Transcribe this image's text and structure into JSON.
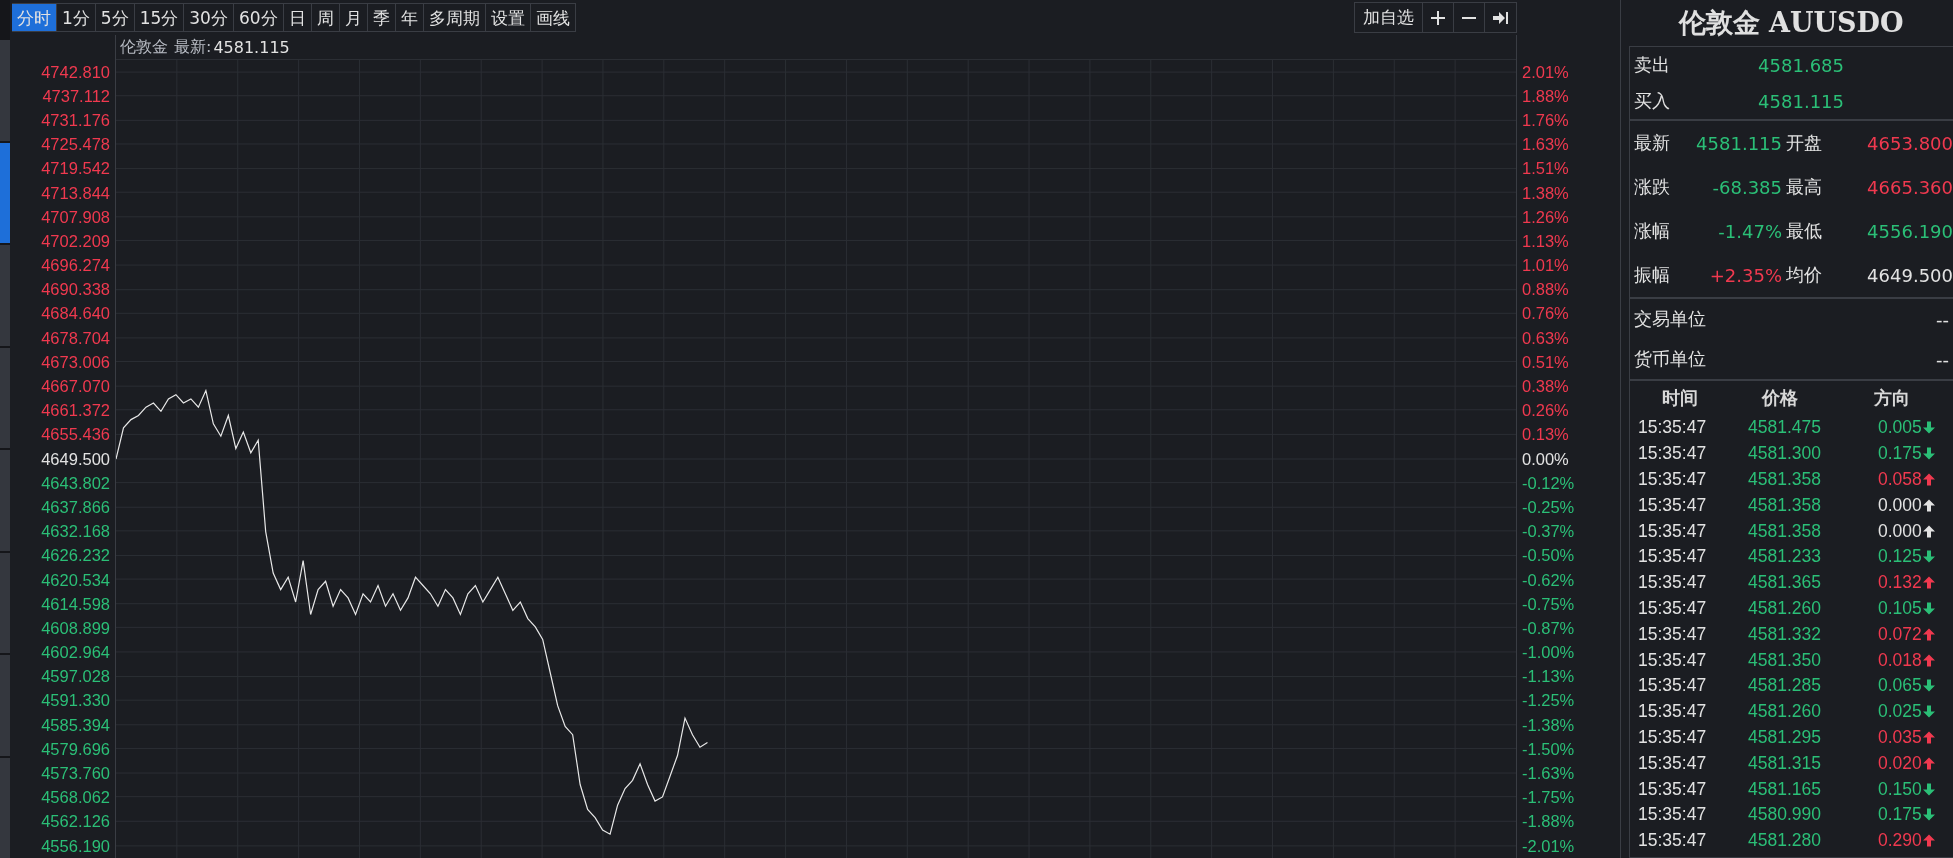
{
  "side_tabs": [
    {
      "selected": false
    },
    {
      "selected": true
    },
    {
      "selected": false
    },
    {
      "selected": false
    },
    {
      "selected": false
    },
    {
      "selected": false
    },
    {
      "selected": false
    },
    {
      "selected": false
    }
  ],
  "periods": [
    {
      "label": "分时",
      "selected": true
    },
    {
      "label": "1分",
      "selected": false
    },
    {
      "label": "5分",
      "selected": false
    },
    {
      "label": "15分",
      "selected": false
    },
    {
      "label": "30分",
      "selected": false
    },
    {
      "label": "60分",
      "selected": false
    },
    {
      "label": "日",
      "selected": false
    },
    {
      "label": "周",
      "selected": false
    },
    {
      "label": "月",
      "selected": false
    },
    {
      "label": "季",
      "selected": false
    },
    {
      "label": "年",
      "selected": false
    },
    {
      "label": "多周期",
      "selected": false
    },
    {
      "label": "设置",
      "selected": false
    },
    {
      "label": "画线",
      "selected": false
    }
  ],
  "toolbar_actions": {
    "watchlist": "加自选"
  },
  "chart_header": {
    "instrument": "伦敦金",
    "latest_label": "最新:",
    "latest": "4581.115"
  },
  "chart": {
    "right_axis_labels": [
      {
        "label": "2.01%",
        "color": "#f0394f"
      },
      {
        "label": "1.88%",
        "color": "#f0394f"
      },
      {
        "label": "1.76%",
        "color": "#f0394f"
      },
      {
        "label": "1.63%",
        "color": "#f0394f"
      },
      {
        "label": "1.51%",
        "color": "#f0394f"
      },
      {
        "label": "1.38%",
        "color": "#f0394f"
      },
      {
        "label": "1.26%",
        "color": "#f0394f"
      },
      {
        "label": "1.13%",
        "color": "#f0394f"
      },
      {
        "label": "1.01%",
        "color": "#f0394f"
      },
      {
        "label": "0.88%",
        "color": "#f0394f"
      },
      {
        "label": "0.76%",
        "color": "#f0394f"
      },
      {
        "label": "0.63%",
        "color": "#f0394f"
      },
      {
        "label": "0.51%",
        "color": "#f0394f"
      },
      {
        "label": "0.38%",
        "color": "#f0394f"
      },
      {
        "label": "0.26%",
        "color": "#f0394f"
      },
      {
        "label": "0.13%",
        "color": "#f0394f"
      },
      {
        "label": "0.00%",
        "color": "#e2e2e2"
      },
      {
        "label": "-0.12%",
        "color": "#2bbf77"
      },
      {
        "label": "-0.25%",
        "color": "#2bbf77"
      },
      {
        "label": "-0.37%",
        "color": "#2bbf77"
      },
      {
        "label": "-0.50%",
        "color": "#2bbf77"
      },
      {
        "label": "-0.62%",
        "color": "#2bbf77"
      },
      {
        "label": "-0.75%",
        "color": "#2bbf77"
      },
      {
        "label": "-0.87%",
        "color": "#2bbf77"
      },
      {
        "label": "-1.00%",
        "color": "#2bbf77"
      },
      {
        "label": "-1.13%",
        "color": "#2bbf77"
      },
      {
        "label": "-1.25%",
        "color": "#2bbf77"
      },
      {
        "label": "-1.38%",
        "color": "#2bbf77"
      },
      {
        "label": "-1.50%",
        "color": "#2bbf77"
      },
      {
        "label": "-1.63%",
        "color": "#2bbf77"
      },
      {
        "label": "-1.75%",
        "color": "#2bbf77"
      },
      {
        "label": "-1.88%",
        "color": "#2bbf77"
      },
      {
        "label": "-2.01%",
        "color": "#2bbf77"
      }
    ],
    "chart_data": {
      "type": "line",
      "ylim": [
        4553.27,
        4745.73
      ],
      "grid": true,
      "yticks": [
        {
          "value": 4742.81,
          "label": "4742.810"
        },
        {
          "value": 4737.112,
          "label": "4737.112"
        },
        {
          "value": 4731.176,
          "label": "4731.176"
        },
        {
          "value": 4725.478,
          "label": "4725.478"
        },
        {
          "value": 4719.542,
          "label": "4719.542"
        },
        {
          "value": 4713.844,
          "label": "4713.844"
        },
        {
          "value": 4707.908,
          "label": "4707.908"
        },
        {
          "value": 4702.209,
          "label": "4702.209"
        },
        {
          "value": 4696.274,
          "label": "4696.274"
        },
        {
          "value": 4690.338,
          "label": "4690.338"
        },
        {
          "value": 4684.64,
          "label": "4684.640"
        },
        {
          "value": 4678.704,
          "label": "4678.704"
        },
        {
          "value": 4673.006,
          "label": "4673.006"
        },
        {
          "value": 4667.07,
          "label": "4667.070"
        },
        {
          "value": 4661.372,
          "label": "4661.372"
        },
        {
          "value": 4655.436,
          "label": "4655.436"
        },
        {
          "value": 4649.5,
          "label": "4649.500"
        },
        {
          "value": 4643.802,
          "label": "4643.802"
        },
        {
          "value": 4637.866,
          "label": "4637.866"
        },
        {
          "value": 4632.168,
          "label": "4632.168"
        },
        {
          "value": 4626.232,
          "label": "4626.232"
        },
        {
          "value": 4620.534,
          "label": "4620.534"
        },
        {
          "value": 4614.598,
          "label": "4614.598"
        },
        {
          "value": 4608.899,
          "label": "4608.899"
        },
        {
          "value": 4602.964,
          "label": "4602.964"
        },
        {
          "value": 4597.028,
          "label": "4597.028"
        },
        {
          "value": 4591.33,
          "label": "4591.330"
        },
        {
          "value": 4585.394,
          "label": "4585.394"
        },
        {
          "value": 4579.696,
          "label": "4579.696"
        },
        {
          "value": 4573.76,
          "label": "4573.760"
        },
        {
          "value": 4568.062,
          "label": "4568.062"
        },
        {
          "value": 4562.126,
          "label": "4562.126"
        },
        {
          "value": 4556.19,
          "label": "4556.190"
        }
      ],
      "categories": [
        null,
        null,
        null,
        null,
        null,
        null,
        null,
        null,
        null,
        null,
        null,
        null,
        null,
        null,
        null,
        null,
        null,
        null,
        null,
        null,
        null,
        null,
        null,
        null,
        null,
        null,
        null,
        null,
        null,
        null,
        null,
        null,
        null,
        null,
        null,
        null,
        null,
        null,
        null,
        null,
        null,
        null,
        null,
        null,
        null,
        null,
        null,
        null,
        null,
        null,
        null,
        null,
        null,
        null,
        null,
        null,
        null,
        null,
        null,
        null,
        null,
        null,
        null,
        null,
        null,
        null,
        null,
        null,
        null,
        null,
        null,
        null,
        null,
        null,
        null,
        null,
        null,
        null,
        null,
        null,
        null,
        null,
        null,
        null,
        null,
        null,
        null,
        null,
        null,
        null,
        null,
        null,
        null,
        null,
        null,
        null,
        null,
        null,
        null,
        null,
        null,
        null,
        null,
        null,
        null,
        null,
        null,
        null,
        null,
        null,
        null,
        null,
        null,
        null,
        null,
        null,
        null,
        null,
        null,
        null,
        null,
        null,
        null,
        null,
        null,
        null,
        null,
        null,
        null,
        null,
        null,
        null,
        null,
        null,
        null,
        null,
        null,
        null,
        null,
        null,
        null,
        null,
        null,
        null,
        null,
        null,
        null,
        null,
        null,
        null,
        null,
        null,
        null,
        null,
        null,
        null,
        null,
        null,
        null,
        null,
        null,
        null,
        null,
        null,
        null,
        null,
        null,
        null,
        null,
        null,
        null,
        null,
        null,
        null,
        null,
        null,
        null,
        null,
        null,
        null,
        null,
        null,
        null,
        null,
        null,
        null,
        null,
        null
      ],
      "series": [
        {
          "color": "#e8e8e8",
          "values": [
            4649.5,
            4657,
            4659,
            4660,
            4662,
            4663,
            4661,
            4664,
            4665,
            4663,
            4664,
            4662,
            4666,
            4658,
            4655,
            4660,
            4652,
            4656,
            4651,
            4654,
            4632,
            4622,
            4618,
            4621,
            4615,
            4625,
            4612,
            4618,
            4620,
            4614,
            4618,
            4616,
            4612,
            4617,
            4615,
            4619,
            4614,
            4617,
            4613,
            4616,
            4621,
            4619,
            4617,
            4614,
            4618,
            4616,
            4612,
            4617,
            4619,
            4615,
            4618,
            4621,
            4617,
            4613,
            4615,
            4611,
            4609,
            4606,
            4598,
            4590,
            4585,
            4583,
            4571,
            4565,
            4563,
            4560,
            4559,
            4566,
            4570,
            4572,
            4576,
            4571,
            4567,
            4568,
            4573,
            4578,
            4587,
            4583,
            4580,
            4581.1,
            null,
            null,
            null,
            null,
            null,
            null,
            null,
            null,
            null,
            null,
            null,
            null,
            null,
            null,
            null,
            null,
            null,
            null,
            null,
            null,
            null,
            null,
            null,
            null,
            null,
            null,
            null,
            null,
            null,
            null,
            null,
            null,
            null,
            null,
            null,
            null,
            null,
            null,
            null,
            null,
            null,
            null,
            null,
            null,
            null,
            null,
            null,
            null,
            null,
            null,
            null,
            null,
            null,
            null,
            null,
            null,
            null,
            null,
            null,
            null,
            null,
            null,
            null,
            null,
            null,
            null,
            null,
            null,
            null,
            null,
            null,
            null,
            null,
            null,
            null,
            null,
            null,
            null,
            null,
            null,
            null,
            null,
            null,
            null,
            null,
            null,
            null,
            null,
            null,
            null,
            null,
            null,
            null,
            null,
            null,
            null,
            null,
            null,
            null,
            null,
            null,
            null,
            null,
            null,
            null,
            null,
            null,
            null
          ]
        }
      ]
    }
  },
  "panel": {
    "title": "伦敦金 AUUSDO",
    "bid_ask": [
      {
        "label": "卖出",
        "value": "4581.685",
        "color": "#2bbf77"
      },
      {
        "label": "买入",
        "value": "4581.115",
        "color": "#2bbf77"
      }
    ],
    "quotes": [
      {
        "label": "最新",
        "value": "4581.115",
        "color": "#2bbf77"
      },
      {
        "label": "开盘",
        "value": "4653.800",
        "color": "#f0394f"
      },
      {
        "label": "涨跌",
        "value": "-68.385",
        "color": "#2bbf77"
      },
      {
        "label": "最高",
        "value": "4665.360",
        "color": "#f0394f"
      },
      {
        "label": "涨幅",
        "value": "-1.47%",
        "color": "#2bbf77"
      },
      {
        "label": "最低",
        "value": "4556.190",
        "color": "#2bbf77"
      },
      {
        "label": "振幅",
        "value": "+2.35%",
        "color": "#f0394f"
      },
      {
        "label": "均价",
        "value": "4649.500",
        "color": "#e2e2e2"
      }
    ],
    "units": [
      {
        "label": "交易单位",
        "value": "--"
      },
      {
        "label": "货币单位",
        "value": "--"
      }
    ],
    "trade_columns": [
      "时间",
      "价格",
      "方向"
    ],
    "trades": [
      {
        "time": "15:35:47",
        "price": {
          "value": "4581.475",
          "color": "#2bbf77"
        },
        "change": {
          "value": "0.005",
          "color": "#2bbf77",
          "kind": "down"
        }
      },
      {
        "time": "15:35:47",
        "price": {
          "value": "4581.300",
          "color": "#2bbf77"
        },
        "change": {
          "value": "0.175",
          "color": "#2bbf77",
          "kind": "down"
        }
      },
      {
        "time": "15:35:47",
        "price": {
          "value": "4581.358",
          "color": "#2bbf77"
        },
        "change": {
          "value": "0.058",
          "color": "#f0394f",
          "kind": "up"
        }
      },
      {
        "time": "15:35:47",
        "price": {
          "value": "4581.358",
          "color": "#2bbf77"
        },
        "change": {
          "value": "0.000",
          "color": "#e2e2e2",
          "kind": "up"
        }
      },
      {
        "time": "15:35:47",
        "price": {
          "value": "4581.358",
          "color": "#2bbf77"
        },
        "change": {
          "value": "0.000",
          "color": "#e2e2e2",
          "kind": "up"
        }
      },
      {
        "time": "15:35:47",
        "price": {
          "value": "4581.233",
          "color": "#2bbf77"
        },
        "change": {
          "value": "0.125",
          "color": "#2bbf77",
          "kind": "down"
        }
      },
      {
        "time": "15:35:47",
        "price": {
          "value": "4581.365",
          "color": "#2bbf77"
        },
        "change": {
          "value": "0.132",
          "color": "#f0394f",
          "kind": "up"
        }
      },
      {
        "time": "15:35:47",
        "price": {
          "value": "4581.260",
          "color": "#2bbf77"
        },
        "change": {
          "value": "0.105",
          "color": "#2bbf77",
          "kind": "down"
        }
      },
      {
        "time": "15:35:47",
        "price": {
          "value": "4581.332",
          "color": "#2bbf77"
        },
        "change": {
          "value": "0.072",
          "color": "#f0394f",
          "kind": "up"
        }
      },
      {
        "time": "15:35:47",
        "price": {
          "value": "4581.350",
          "color": "#2bbf77"
        },
        "change": {
          "value": "0.018",
          "color": "#f0394f",
          "kind": "up"
        }
      },
      {
        "time": "15:35:47",
        "price": {
          "value": "4581.285",
          "color": "#2bbf77"
        },
        "change": {
          "value": "0.065",
          "color": "#2bbf77",
          "kind": "down"
        }
      },
      {
        "time": "15:35:47",
        "price": {
          "value": "4581.260",
          "color": "#2bbf77"
        },
        "change": {
          "value": "0.025",
          "color": "#2bbf77",
          "kind": "down"
        }
      },
      {
        "time": "15:35:47",
        "price": {
          "value": "4581.295",
          "color": "#2bbf77"
        },
        "change": {
          "value": "0.035",
          "color": "#f0394f",
          "kind": "up"
        }
      },
      {
        "time": "15:35:47",
        "price": {
          "value": "4581.315",
          "color": "#2bbf77"
        },
        "change": {
          "value": "0.020",
          "color": "#f0394f",
          "kind": "up"
        }
      },
      {
        "time": "15:35:47",
        "price": {
          "value": "4581.165",
          "color": "#2bbf77"
        },
        "change": {
          "value": "0.150",
          "color": "#2bbf77",
          "kind": "down"
        }
      },
      {
        "time": "15:35:47",
        "price": {
          "value": "4580.990",
          "color": "#2bbf77"
        },
        "change": {
          "value": "0.175",
          "color": "#2bbf77",
          "kind": "down"
        }
      },
      {
        "time": "15:35:47",
        "price": {
          "value": "4581.280",
          "color": "#2bbf77"
        },
        "change": {
          "value": "0.290",
          "color": "#f0394f",
          "kind": "up"
        }
      }
    ]
  }
}
